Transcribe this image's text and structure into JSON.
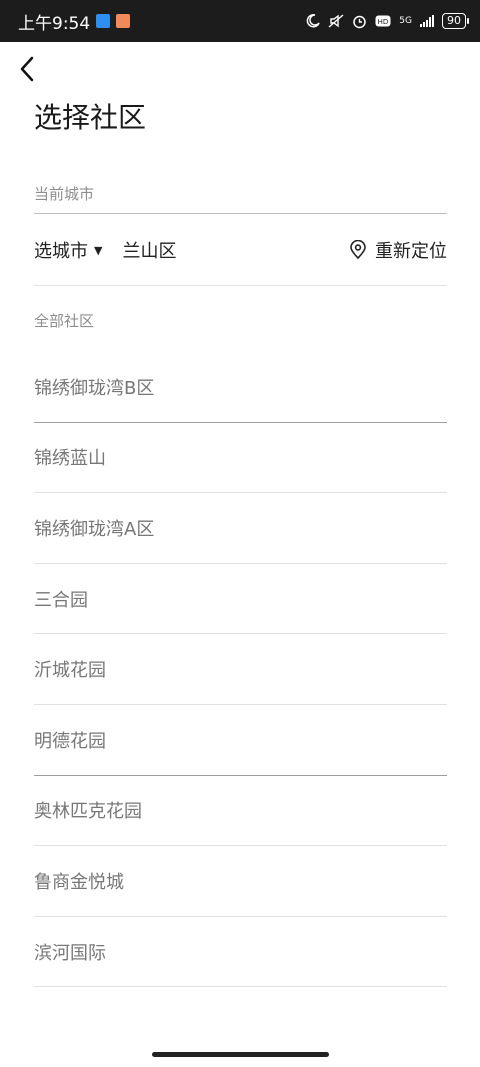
{
  "status_bar": {
    "time": "上午9:54",
    "network": "5G",
    "battery": "90",
    "colors": {
      "background": "#1c1c1c",
      "badge_blue": "#2f8ff0",
      "badge_orange": "#f08a5d"
    }
  },
  "header": {
    "title": "选择社区"
  },
  "current_city": {
    "label": "当前城市",
    "city_select": "选城市",
    "district": "兰山区",
    "relocate": "重新定位"
  },
  "all_communities": {
    "label": "全部社区",
    "items": [
      "锦绣御珑湾B区",
      "锦绣蓝山",
      "锦绣御珑湾A区",
      "三合园",
      "沂城花园",
      "明德花园",
      "奥林匹克花园",
      "鲁商金悦城",
      "滨河国际"
    ]
  }
}
